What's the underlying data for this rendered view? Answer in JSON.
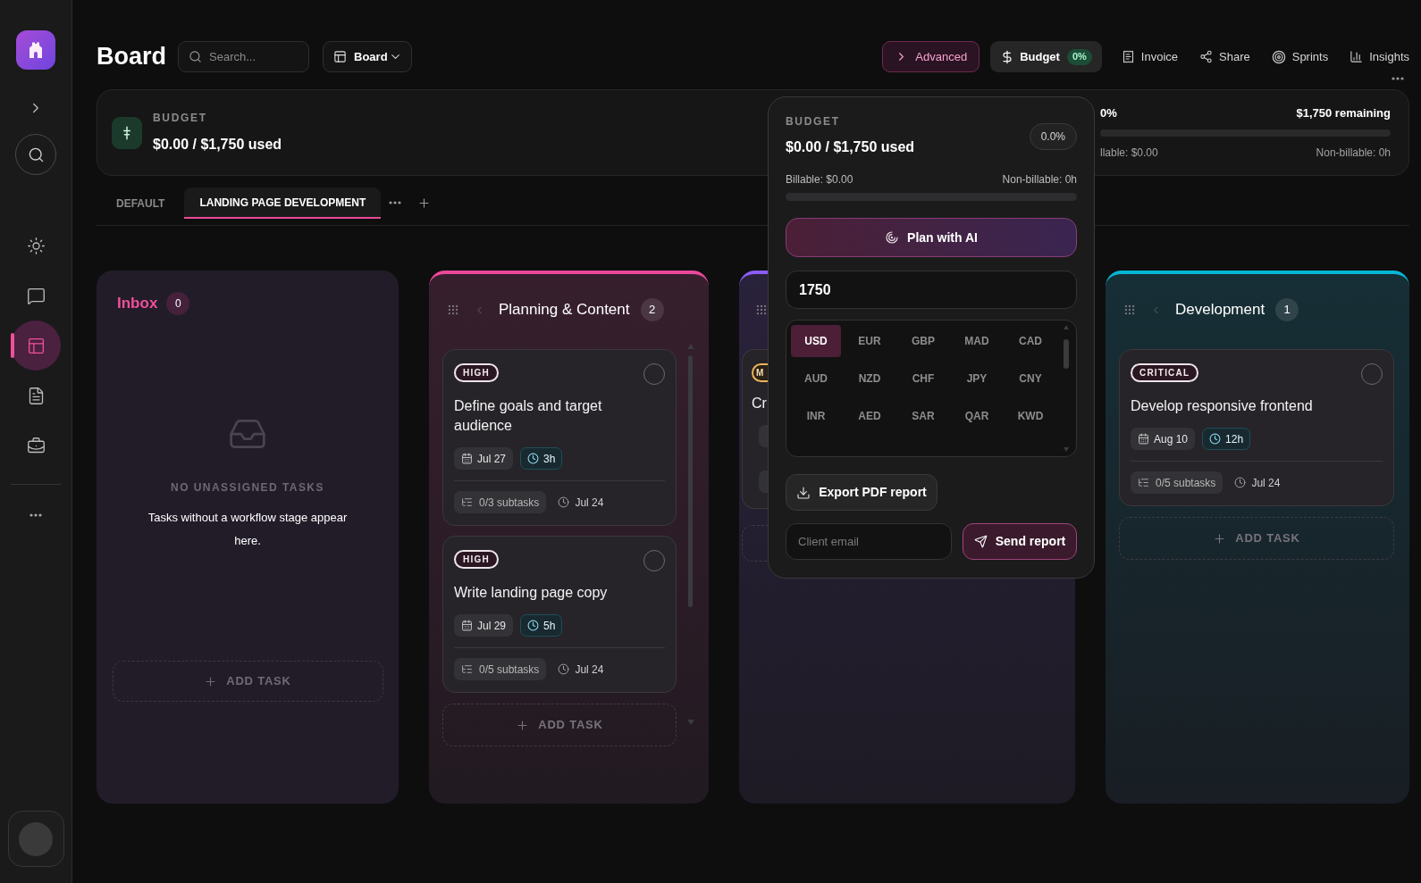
{
  "sidebar": {
    "nav": [
      {
        "kind": "theme",
        "selected": false
      },
      {
        "kind": "chat",
        "selected": false
      },
      {
        "kind": "board",
        "selected": true
      },
      {
        "kind": "docs",
        "selected": false
      },
      {
        "kind": "tools",
        "selected": false
      }
    ]
  },
  "header": {
    "title": "Board",
    "search": {
      "placeholder": "Search..."
    },
    "view_select": {
      "value": "Board"
    },
    "actions": [
      {
        "kind": "advanced",
        "label": "Advanced"
      },
      {
        "kind": "budget",
        "label": "Budget",
        "badge": "0%"
      },
      {
        "kind": "invoice",
        "label": "Invoice"
      },
      {
        "kind": "share",
        "label": "Share"
      },
      {
        "kind": "sprints",
        "label": "Sprints"
      },
      {
        "kind": "insights",
        "label": "Insights"
      }
    ]
  },
  "budget_summary": {
    "label": "BUDGET",
    "amount": "$0.00 / $1,750 used",
    "percent": "0%",
    "remaining": "$1,750 remaining",
    "level": 0,
    "billable": "llable: $0.00",
    "non_billable": "Non-billable: 0h"
  },
  "tabs": [
    {
      "label": "DEFAULT",
      "selected": false
    },
    {
      "label": "LANDING PAGE DEVELOPMENT",
      "selected": true
    }
  ],
  "columns": [
    {
      "kind": "inbox",
      "title": "Inbox",
      "count": "0",
      "empty_title": "NO UNASSIGNED TASKS",
      "empty_text": "Tasks without a workflow stage appear here.",
      "add_label": "ADD TASK"
    },
    {
      "kind": "stage",
      "title": "Planning & Content",
      "count": "2",
      "color": "#ec4899",
      "tasks": [
        {
          "priority": {
            "label": "HIGH",
            "color": "#eee4e8"
          },
          "title": "Define goals and target audience",
          "due": "Jul 27",
          "estimate": "3h",
          "subtasks": "0/3 subtasks",
          "created": "Jul 24",
          "done": false
        },
        {
          "priority": {
            "label": "HIGH",
            "color": "#eee4e8"
          },
          "title": "Write landing page copy",
          "due": "Jul 29",
          "estimate": "5h",
          "subtasks": "0/5 subtasks",
          "created": "Jul 24",
          "done": false
        }
      ],
      "add_label": "ADD TASK"
    },
    {
      "kind": "covered",
      "color": "#8b5cf6",
      "tasks": [
        {
          "priority": {
            "label": "M",
            "color": "#f0b45a"
          },
          "title": "Cr"
        }
      ]
    },
    {
      "kind": "stage",
      "title": "Development",
      "count": "1",
      "color": "#06b6d4",
      "tasks": [
        {
          "priority": {
            "label": "CRITICAL",
            "color": "#eee4e8"
          },
          "title": "Develop responsive frontend",
          "due": "Aug 10",
          "estimate": "12h",
          "subtasks": "0/5 subtasks",
          "created": "Jul 24",
          "done": false
        }
      ],
      "add_label": "ADD TASK"
    }
  ],
  "budget_popover": {
    "label": "BUDGET",
    "amount": "$0.00 / $1,750 used",
    "percent": "0.0%",
    "billable": "Billable: $0.00",
    "non_billable": "Non-billable: 0h",
    "level": 0,
    "plan_button": "Plan with AI",
    "amount_field": {
      "value": "1750"
    },
    "currencies": [
      {
        "code": "USD",
        "selected": true
      },
      {
        "code": "EUR",
        "selected": false
      },
      {
        "code": "GBP",
        "selected": false
      },
      {
        "code": "MAD",
        "selected": false
      },
      {
        "code": "CAD",
        "selected": false
      },
      {
        "code": "AUD",
        "selected": false
      },
      {
        "code": "NZD",
        "selected": false
      },
      {
        "code": "CHF",
        "selected": false
      },
      {
        "code": "JPY",
        "selected": false
      },
      {
        "code": "CNY",
        "selected": false
      },
      {
        "code": "INR",
        "selected": false
      },
      {
        "code": "AED",
        "selected": false
      },
      {
        "code": "SAR",
        "selected": false
      },
      {
        "code": "QAR",
        "selected": false
      },
      {
        "code": "KWD",
        "selected": false
      }
    ],
    "export_button": "Export PDF report",
    "email_field": {
      "placeholder": "Client email"
    },
    "send_button": "Send report"
  }
}
